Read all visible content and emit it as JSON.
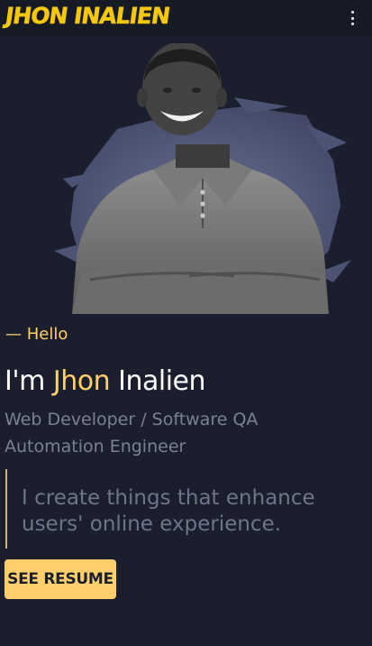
{
  "header": {
    "logo_text": "JHON INALIEN",
    "menu_icon": "vertical-dots-icon"
  },
  "hero": {
    "image_alt": "portrait-photo"
  },
  "intro": {
    "hello": "— Hello",
    "name_prefix": "I'm ",
    "name_highlight": "Jhon",
    "name_suffix": " Inalien",
    "role_line1": "Web Developer / Software QA",
    "role_line2": "Automation Engineer",
    "quote": "I create things that enhance users' online experience.",
    "button": "SEE RESUME"
  },
  "colors": {
    "accent": "#ffcf6b",
    "logo": "#f6c80b",
    "background": "#1b1f2d",
    "muted": "#7b8094"
  }
}
